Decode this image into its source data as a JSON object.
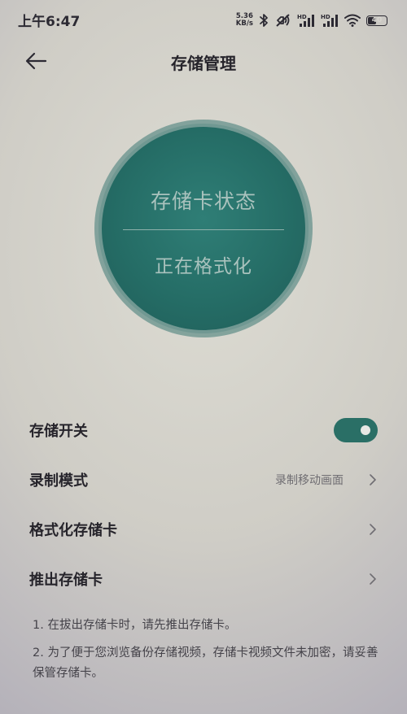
{
  "status_bar": {
    "time": "上午6:47",
    "net_speed_value": "5.36",
    "net_speed_unit": "KB/s",
    "icons": [
      "bluetooth-icon",
      "mute-icon",
      "signal-hd-icon",
      "signal-hd-icon",
      "wifi-icon",
      "battery-icon"
    ],
    "battery_level": "40"
  },
  "header": {
    "back_icon": "arrow-left-icon",
    "title": "存储管理"
  },
  "status_circle": {
    "title": "存储卡状态",
    "status": "正在格式化",
    "color": "#256d66"
  },
  "settings": {
    "storage_switch": {
      "label": "存储开关",
      "enabled": true,
      "accent": "#2a6f66"
    },
    "record_mode": {
      "label": "录制模式",
      "value": "录制移动画面"
    },
    "format_card": {
      "label": "格式化存储卡"
    },
    "eject_card": {
      "label": "推出存储卡"
    }
  },
  "notes": [
    "1. 在拔出存储卡时，请先推出存储卡。",
    "2. 为了便于您浏览备份存储视频，存储卡视频文件未加密，请妥善保管存储卡。"
  ]
}
